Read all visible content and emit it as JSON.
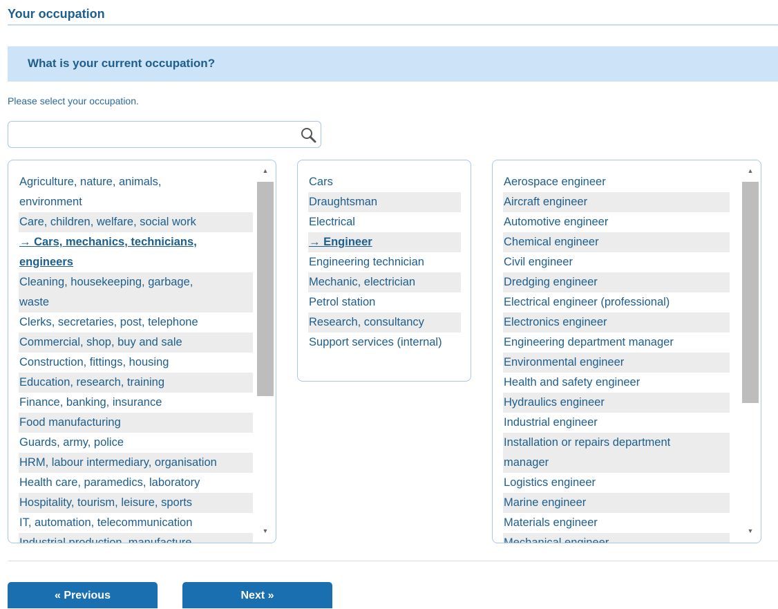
{
  "section": {
    "title": "Your occupation"
  },
  "question": {
    "title": "What is your current occupation?"
  },
  "instruction": "Please select your occupation.",
  "search": {
    "value": "",
    "placeholder": "",
    "icon": "search-icon"
  },
  "categories": {
    "items": [
      {
        "label": "Agriculture, nature, animals,",
        "shade": false
      },
      {
        "label": "environment",
        "shade": false
      },
      {
        "label": "Care, children, welfare, social work",
        "shade": true
      },
      {
        "label": "→ Cars, mechanics, technicians,",
        "shade": false,
        "selected": true
      },
      {
        "label": "engineers",
        "shade": false,
        "selected": true
      },
      {
        "label": "Cleaning, housekeeping, garbage,",
        "shade": true
      },
      {
        "label": "waste",
        "shade": true
      },
      {
        "label": "Clerks, secretaries, post, telephone",
        "shade": false
      },
      {
        "label": "Commercial, shop, buy and sale",
        "shade": true
      },
      {
        "label": "Construction, fittings, housing",
        "shade": false
      },
      {
        "label": "Education, research, training",
        "shade": true
      },
      {
        "label": "Finance, banking, insurance",
        "shade": false
      },
      {
        "label": "Food manufacturing",
        "shade": true
      },
      {
        "label": "Guards, army, police",
        "shade": false
      },
      {
        "label": "HRM, labour intermediary, organisation",
        "shade": true
      },
      {
        "label": "Health care, paramedics, laboratory",
        "shade": false
      },
      {
        "label": "Hospitality, tourism, leisure, sports",
        "shade": true
      },
      {
        "label": "IT, automation, telecommunication",
        "shade": false
      },
      {
        "label": "Industrial production, manufacture",
        "shade": true
      }
    ]
  },
  "subcategories": {
    "items": [
      {
        "label": "Cars",
        "shade": false
      },
      {
        "label": "Draughtsman",
        "shade": true
      },
      {
        "label": "Electrical",
        "shade": false
      },
      {
        "label": "→ Engineer",
        "shade": true,
        "selected": true
      },
      {
        "label": "Engineering technician",
        "shade": false
      },
      {
        "label": "Mechanic, electrician",
        "shade": true
      },
      {
        "label": "Petrol station",
        "shade": false
      },
      {
        "label": "Research, consultancy",
        "shade": true
      },
      {
        "label": "Support services (internal)",
        "shade": false
      }
    ]
  },
  "occupations": {
    "items": [
      {
        "label": "Aerospace engineer",
        "shade": false
      },
      {
        "label": "Aircraft engineer",
        "shade": true
      },
      {
        "label": "Automotive engineer",
        "shade": false
      },
      {
        "label": "Chemical engineer",
        "shade": true
      },
      {
        "label": "Civil engineer",
        "shade": false
      },
      {
        "label": "Dredging engineer",
        "shade": true
      },
      {
        "label": "Electrical engineer (professional)",
        "shade": false
      },
      {
        "label": "Electronics engineer",
        "shade": true
      },
      {
        "label": "Engineering department manager",
        "shade": false
      },
      {
        "label": "Environmental engineer",
        "shade": true
      },
      {
        "label": "Health and safety engineer",
        "shade": false
      },
      {
        "label": "Hydraulics engineer",
        "shade": true
      },
      {
        "label": "Industrial engineer",
        "shade": false
      },
      {
        "label": "Installation or repairs department",
        "shade": true
      },
      {
        "label": "manager",
        "shade": true
      },
      {
        "label": "Logistics engineer",
        "shade": false
      },
      {
        "label": "Marine engineer",
        "shade": true
      },
      {
        "label": "Materials engineer",
        "shade": false
      },
      {
        "label": "Mechanical engineer",
        "shade": true
      }
    ]
  },
  "buttons": {
    "previous": "« Previous",
    "next": "Next »"
  },
  "colors": {
    "accent": "#1a6fb0",
    "heading": "#1e5e8c",
    "question_bg": "#cde3f8",
    "row_shade": "#ececec"
  }
}
